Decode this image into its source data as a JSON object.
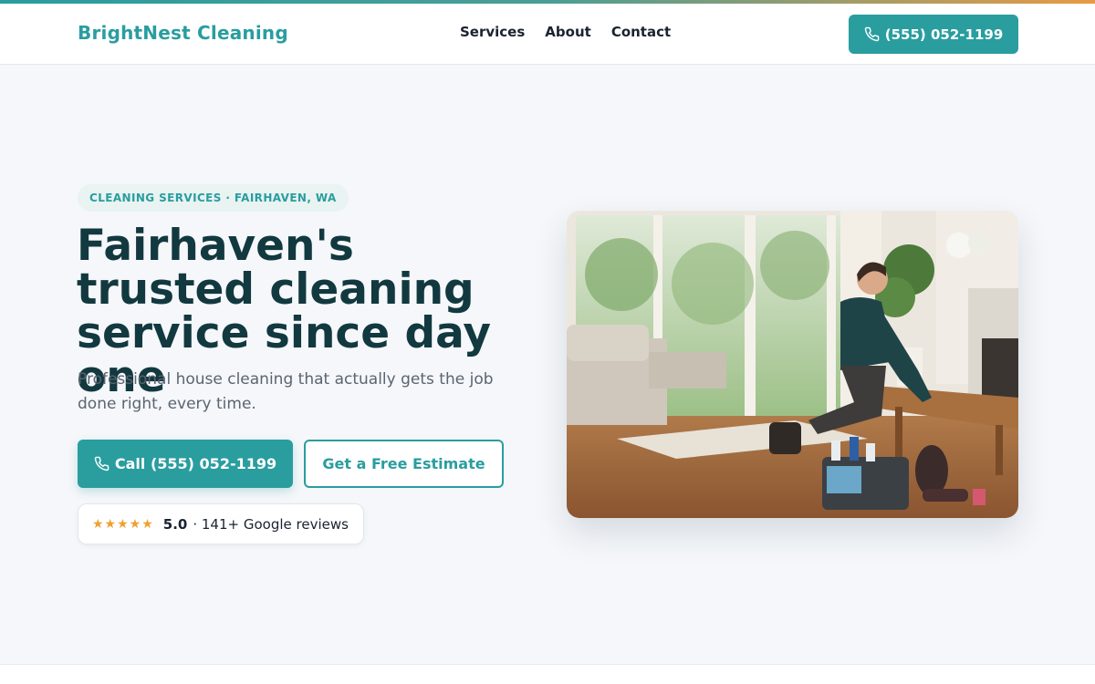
{
  "brand": {
    "name": "BrightNest Cleaning"
  },
  "nav": {
    "items": [
      "Services",
      "About",
      "Contact"
    ]
  },
  "header": {
    "phone_label": "(555) 052-1199"
  },
  "hero": {
    "badge": "CLEANING SERVICES · FAIRHAVEN, WA",
    "title": "Fairhaven's trusted cleaning service since day one",
    "subtitle": "Professional house cleaning that actually gets the job done right, every time.",
    "cta_call": "Call (555) 052-1199",
    "cta_estimate": "Get a Free Estimate",
    "reviews": {
      "stars": "★★★★★",
      "rating": "5.0",
      "text": "· 141+ Google reviews"
    },
    "image": "cleaner-wiping-coffee-table-photo"
  },
  "icons": {
    "phone": "phone-icon",
    "star": "star-icon"
  },
  "colors": {
    "brand": "#2a9d9f",
    "heading": "#12393f",
    "star": "#f0a030",
    "background": "#f5f7fa"
  }
}
